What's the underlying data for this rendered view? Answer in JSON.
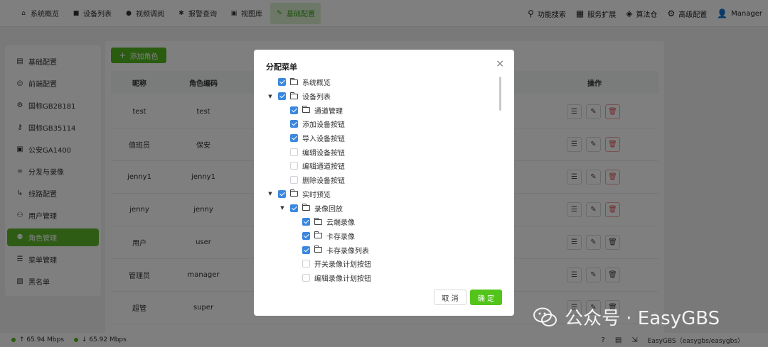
{
  "topnav": {
    "items": [
      {
        "label": "系统概览",
        "icon": "home-icon"
      },
      {
        "label": "设备列表",
        "icon": "video-camera-icon"
      },
      {
        "label": "视频调阅",
        "icon": "play-circle-icon"
      },
      {
        "label": "报警查询",
        "icon": "alarm-icon"
      },
      {
        "label": "视图库",
        "icon": "image-icon"
      },
      {
        "label": "基础配置",
        "icon": "edit-icon"
      }
    ],
    "right": [
      {
        "label": "功能搜索",
        "icon": "search-icon"
      },
      {
        "label": "服务扩展",
        "icon": "grid-icon"
      },
      {
        "label": "算法仓",
        "icon": "dropbox-icon"
      },
      {
        "label": "高级配置",
        "icon": "gear-icon"
      },
      {
        "label": "Manager",
        "icon": "user-icon"
      }
    ]
  },
  "sidebar": {
    "items": [
      {
        "label": "基础配置",
        "icon": "document-icon"
      },
      {
        "label": "前端配置",
        "icon": "settings-circle-icon"
      },
      {
        "label": "国标GB28181",
        "icon": "gear-icon"
      },
      {
        "label": "国标GB35114",
        "icon": "key-icon"
      },
      {
        "label": "公安GA1400",
        "icon": "image-icon"
      },
      {
        "label": "分发与录像",
        "icon": "link-icon"
      },
      {
        "label": "线路配置",
        "icon": "route-icon"
      },
      {
        "label": "用户管理",
        "icon": "users-icon"
      },
      {
        "label": "角色管理",
        "icon": "role-icon"
      },
      {
        "label": "菜单管理",
        "icon": "menu-icon"
      },
      {
        "label": "黑名单",
        "icon": "blacklist-icon"
      }
    ],
    "active_index": 8
  },
  "main": {
    "add_button": "添加角色",
    "columns": {
      "nickname": "昵称",
      "code": "角色编码",
      "ops": "操作"
    },
    "rows": [
      {
        "nickname": "test",
        "code": "test"
      },
      {
        "nickname": "值班员",
        "code": "保安"
      },
      {
        "nickname": "jenny1",
        "code": "jenny1"
      },
      {
        "nickname": "jenny",
        "code": "jenny"
      },
      {
        "nickname": "用户",
        "code": "user"
      },
      {
        "nickname": "管理员",
        "code": "manager"
      },
      {
        "nickname": "超管",
        "code": "super"
      }
    ]
  },
  "dialog": {
    "title": "分配菜单",
    "close": "×",
    "tree": [
      {
        "label": "系统概览",
        "level": 0,
        "arrow": false,
        "checked": true,
        "folder": true
      },
      {
        "label": "设备列表",
        "level": 0,
        "arrow": true,
        "checked": true,
        "folder": true
      },
      {
        "label": "通道管理",
        "level": 1,
        "arrow": false,
        "checked": true,
        "folder": true
      },
      {
        "label": "添加设备按钮",
        "level": 1,
        "arrow": false,
        "checked": true,
        "folder": false
      },
      {
        "label": "导入设备按钮",
        "level": 1,
        "arrow": false,
        "checked": true,
        "folder": false
      },
      {
        "label": "编辑设备按钮",
        "level": 1,
        "arrow": false,
        "checked": false,
        "folder": false
      },
      {
        "label": "编辑通道按钮",
        "level": 1,
        "arrow": false,
        "checked": false,
        "folder": false
      },
      {
        "label": "删除设备按钮",
        "level": 1,
        "arrow": false,
        "checked": false,
        "folder": false
      },
      {
        "label": "实时预览",
        "level": 0,
        "arrow": true,
        "checked": true,
        "folder": true
      },
      {
        "label": "录像回放",
        "level": 1,
        "arrow": true,
        "checked": true,
        "folder": true
      },
      {
        "label": "云端录像",
        "level": 2,
        "arrow": false,
        "checked": true,
        "folder": true
      },
      {
        "label": "卡存录像",
        "level": 2,
        "arrow": false,
        "checked": true,
        "folder": true
      },
      {
        "label": "卡存录像列表",
        "level": 2,
        "arrow": false,
        "checked": true,
        "folder": true
      },
      {
        "label": "开关录像计划按钮",
        "level": 2,
        "arrow": false,
        "checked": false,
        "folder": false
      },
      {
        "label": "编辑录像计划按钮",
        "level": 2,
        "arrow": false,
        "checked": false,
        "folder": false
      }
    ],
    "cancel": "取 消",
    "ok": "确 定"
  },
  "footer": {
    "up": "65.94 Mbps",
    "down": "65.92 Mbps",
    "brand": "EasyGBS（easygbs/easygbs）"
  },
  "watermark": {
    "text": "公众号 · EasyGBS"
  },
  "colors": {
    "accent": "#52b81e",
    "checkbox": "#3a87e0",
    "danger": "#e45656"
  }
}
